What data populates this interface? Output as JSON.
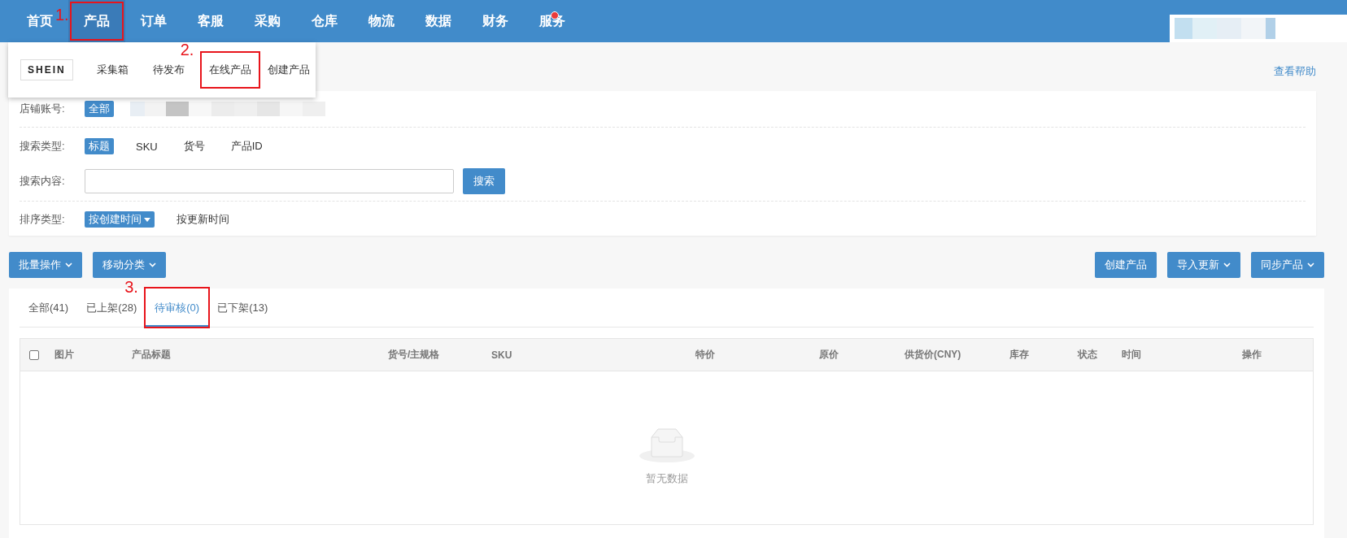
{
  "nav": {
    "items": [
      {
        "label": "首页",
        "selected": false,
        "dot": false
      },
      {
        "label": "产品",
        "selected": true,
        "dot": false,
        "annotation": "1."
      },
      {
        "label": "订单",
        "selected": false,
        "dot": false
      },
      {
        "label": "客服",
        "selected": false,
        "dot": false
      },
      {
        "label": "采购",
        "selected": false,
        "dot": false
      },
      {
        "label": "仓库",
        "selected": false,
        "dot": false
      },
      {
        "label": "物流",
        "selected": false,
        "dot": false
      },
      {
        "label": "数据",
        "selected": false,
        "dot": false
      },
      {
        "label": "财务",
        "selected": false,
        "dot": false
      },
      {
        "label": "服务",
        "selected": false,
        "dot": true
      }
    ]
  },
  "dropdown": {
    "logo": "SHEIN",
    "items": [
      {
        "label": "采集箱"
      },
      {
        "label": "待发布"
      },
      {
        "label": "在线产品",
        "annotation": "2."
      },
      {
        "label": "创建产品"
      }
    ]
  },
  "help_link": "查看帮助",
  "filters": {
    "store_account": {
      "label": "店铺账号:",
      "options": [
        {
          "label": "全部",
          "selected": true
        }
      ]
    },
    "search_type": {
      "label": "搜索类型:",
      "options": [
        {
          "label": "标题",
          "selected": true
        },
        {
          "label": "SKU",
          "selected": false
        },
        {
          "label": "货号",
          "selected": false
        },
        {
          "label": "产品ID",
          "selected": false
        }
      ]
    },
    "search_content": {
      "label": "搜索内容:",
      "button": "搜索"
    },
    "sort_type": {
      "label": "排序类型:",
      "options": [
        {
          "label": "按创建时间",
          "selected": true
        },
        {
          "label": "按更新时间",
          "selected": false
        }
      ]
    }
  },
  "toolbar": {
    "left": [
      {
        "label": "批量操作",
        "dropdown": true
      },
      {
        "label": "移动分类",
        "dropdown": true
      }
    ],
    "right": [
      {
        "label": "创建产品",
        "dropdown": false
      },
      {
        "label": "导入更新",
        "dropdown": true
      },
      {
        "label": "同步产品",
        "dropdown": true
      }
    ]
  },
  "tabs": [
    {
      "label": "全部(41)",
      "selected": false
    },
    {
      "label": "已上架(28)",
      "selected": false
    },
    {
      "label": "待审核(0)",
      "selected": true,
      "annotation": "3."
    },
    {
      "label": "已下架(13)",
      "selected": false
    }
  ],
  "table": {
    "select_all_checked": false,
    "columns": [
      "图片",
      "产品标题",
      "货号/主规格",
      "SKU",
      "特价",
      "原价",
      "供货价(CNY)",
      "库存",
      "状态",
      "时间",
      "操作"
    ],
    "empty_text": "暂无数据"
  }
}
